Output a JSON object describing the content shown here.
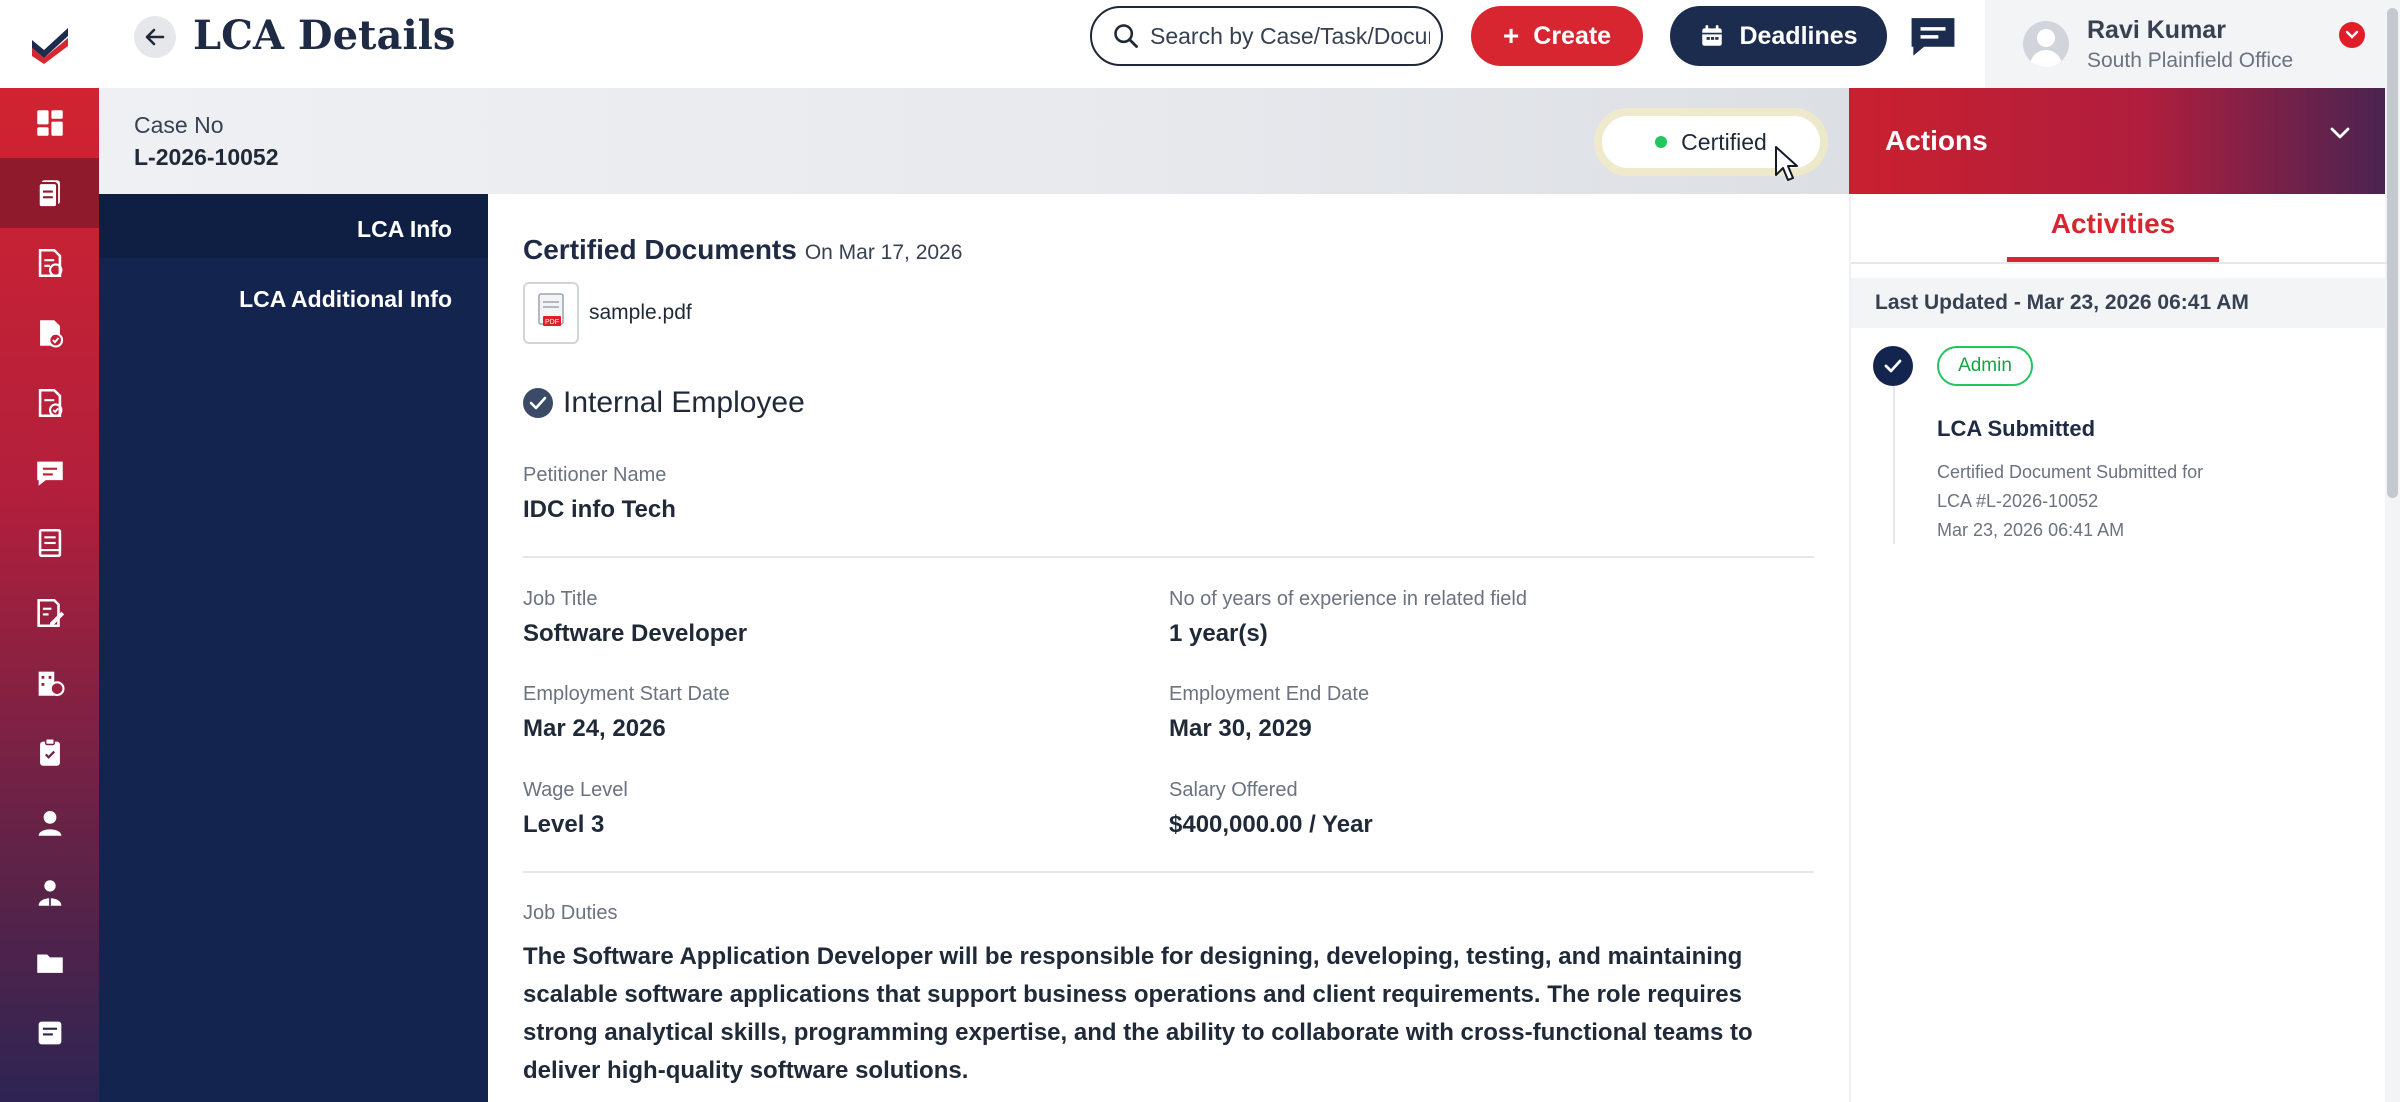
{
  "header": {
    "title": "LCA Details",
    "search_placeholder": "Search by Case/Task/Document",
    "create_label": "Create",
    "deadlines_label": "Deadlines",
    "user_name": "Ravi Kumar",
    "user_office": "South Plainfield Office"
  },
  "case": {
    "label": "Case No",
    "number": "L-2026-10052",
    "status": "Certified"
  },
  "sections": [
    "LCA Info",
    "LCA Additional Info"
  ],
  "certified_documents": {
    "title": "Certified Documents",
    "date": "On Mar 17, 2026",
    "file_name": "sample.pdf",
    "file_type": "PDF"
  },
  "employee": {
    "heading": "Internal Employee",
    "petitioner_label": "Petitioner Name",
    "petitioner_value": "IDC info Tech",
    "job_title_label": "Job Title",
    "job_title_value": "Software Developer",
    "experience_label": "No of years of experience in related field",
    "experience_value": "1 year(s)",
    "start_label": "Employment Start Date",
    "start_value": "Mar 24, 2026",
    "end_label": "Employment End Date",
    "end_value": "Mar 30, 2029",
    "wage_label": "Wage Level",
    "wage_value": "Level 3",
    "salary_label": "Salary Offered",
    "salary_value": "$400,000.00 / Year",
    "duties_label": "Job Duties",
    "duties_value": "The Software Application Developer will be responsible for designing, developing, testing, and maintaining scalable software applications that support business operations and client requirements. The role requires strong analytical skills, programming expertise, and the ability to collaborate with cross-functional teams to deliver high-quality software solutions."
  },
  "actions": {
    "title": "Actions",
    "tab": "Activities",
    "last_updated": "Last Updated - Mar 23, 2026 06:41 AM",
    "activity": {
      "badge": "Admin",
      "title": "LCA Submitted",
      "desc_line1": "Certified Document Submitted for",
      "desc_line2": "LCA #L-2026-10052",
      "timestamp": "Mar 23, 2026 06:41 AM"
    }
  },
  "icons": {
    "rail": [
      "dashboard-icon",
      "cases-icon",
      "documents-check-icon",
      "reports-icon",
      "approved-docs-icon",
      "messages-icon",
      "ledger-icon",
      "edit-forms-icon",
      "buildings-icon",
      "clipboard-icon",
      "user-icon",
      "employee-icon",
      "folder-icon",
      "notes-icon"
    ]
  },
  "colors": {
    "brand_red": "#d7262f",
    "navy": "#13244e",
    "status_green": "#22c55e"
  }
}
